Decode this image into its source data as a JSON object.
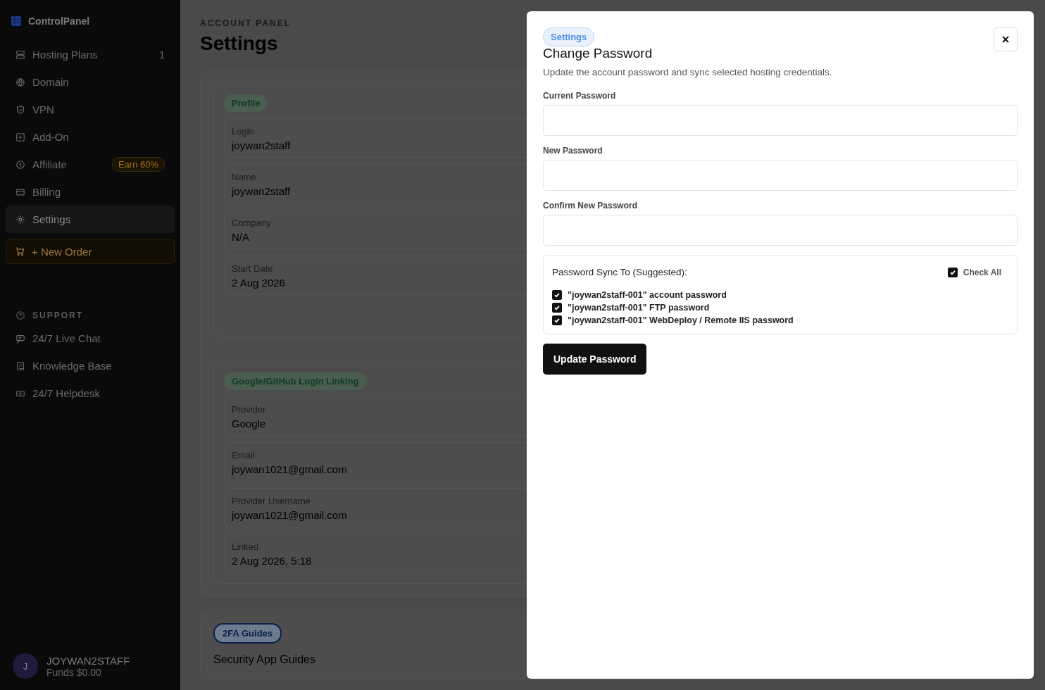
{
  "sidebar": {
    "brand": "ControlPanel",
    "items": [
      {
        "label": "Hosting Plans",
        "count": "1",
        "selected": false
      },
      {
        "label": "Domain",
        "selected": false
      },
      {
        "label": "VPN",
        "selected": false
      },
      {
        "label": "Add-On",
        "selected": false
      },
      {
        "label": "Affiliate",
        "badge": "Earn 60%",
        "selected": false
      },
      {
        "label": "Billing",
        "selected": false
      },
      {
        "label": "Settings",
        "selected": true
      }
    ],
    "new_order": "+ New Order",
    "support_heading": "SUPPORT",
    "support_items": [
      {
        "label": "24/7 Live Chat"
      },
      {
        "label": "Knowledge Base"
      },
      {
        "label": "24/7 Helpdesk"
      }
    ],
    "user": {
      "initial": "J",
      "name": "JOYWAN2STAFF",
      "funds": "Funds $0.00"
    }
  },
  "page": {
    "eyebrow": "ACCOUNT PANEL",
    "title": "Settings",
    "sections": [
      {
        "tag": "Profile",
        "color": "#0f3d1f",
        "fields": [
          {
            "label": "Login",
            "value": "joywan2staff"
          },
          {
            "label": "Name",
            "value": "joywan2staff"
          },
          {
            "label": "Company",
            "value": "N/A"
          },
          {
            "label": "Start Date",
            "value": "2 Aug 2026"
          }
        ]
      },
      {
        "tag": "Google/GitHub Login Linking",
        "color": "#0f3d1f",
        "fields": [
          {
            "label": "Provider",
            "value": "Google"
          },
          {
            "label": "Email",
            "value": "joywan1021@gmail.com"
          },
          {
            "label": "Provider Username",
            "value": "joywan1021@gmail.com"
          },
          {
            "label": "Linked",
            "value": "2 Aug 2026, 5:18"
          }
        ]
      }
    ],
    "guides": {
      "tag": "2FA Guides",
      "color": "#0a1f4a",
      "heading": "Security App Guides"
    }
  },
  "modal": {
    "tag": "Settings",
    "title": "Change Password",
    "description": "Update the account password and sync selected hosting credentials.",
    "fields": [
      {
        "label": "Current Password"
      },
      {
        "label": "New Password"
      },
      {
        "label": "Confirm New Password"
      }
    ],
    "sync": {
      "label": "Password Sync To (Suggested):",
      "check_all": {
        "label": "Check All",
        "checked": true
      },
      "items": [
        {
          "label": "\"joywan2staff-001\" account password",
          "checked": true
        },
        {
          "label": "\"joywan2staff-001\" FTP password",
          "checked": true
        },
        {
          "label": "\"joywan2staff-001\" WebDeploy / Remote IIS password",
          "checked": true
        }
      ]
    },
    "submit": "Update Password"
  }
}
